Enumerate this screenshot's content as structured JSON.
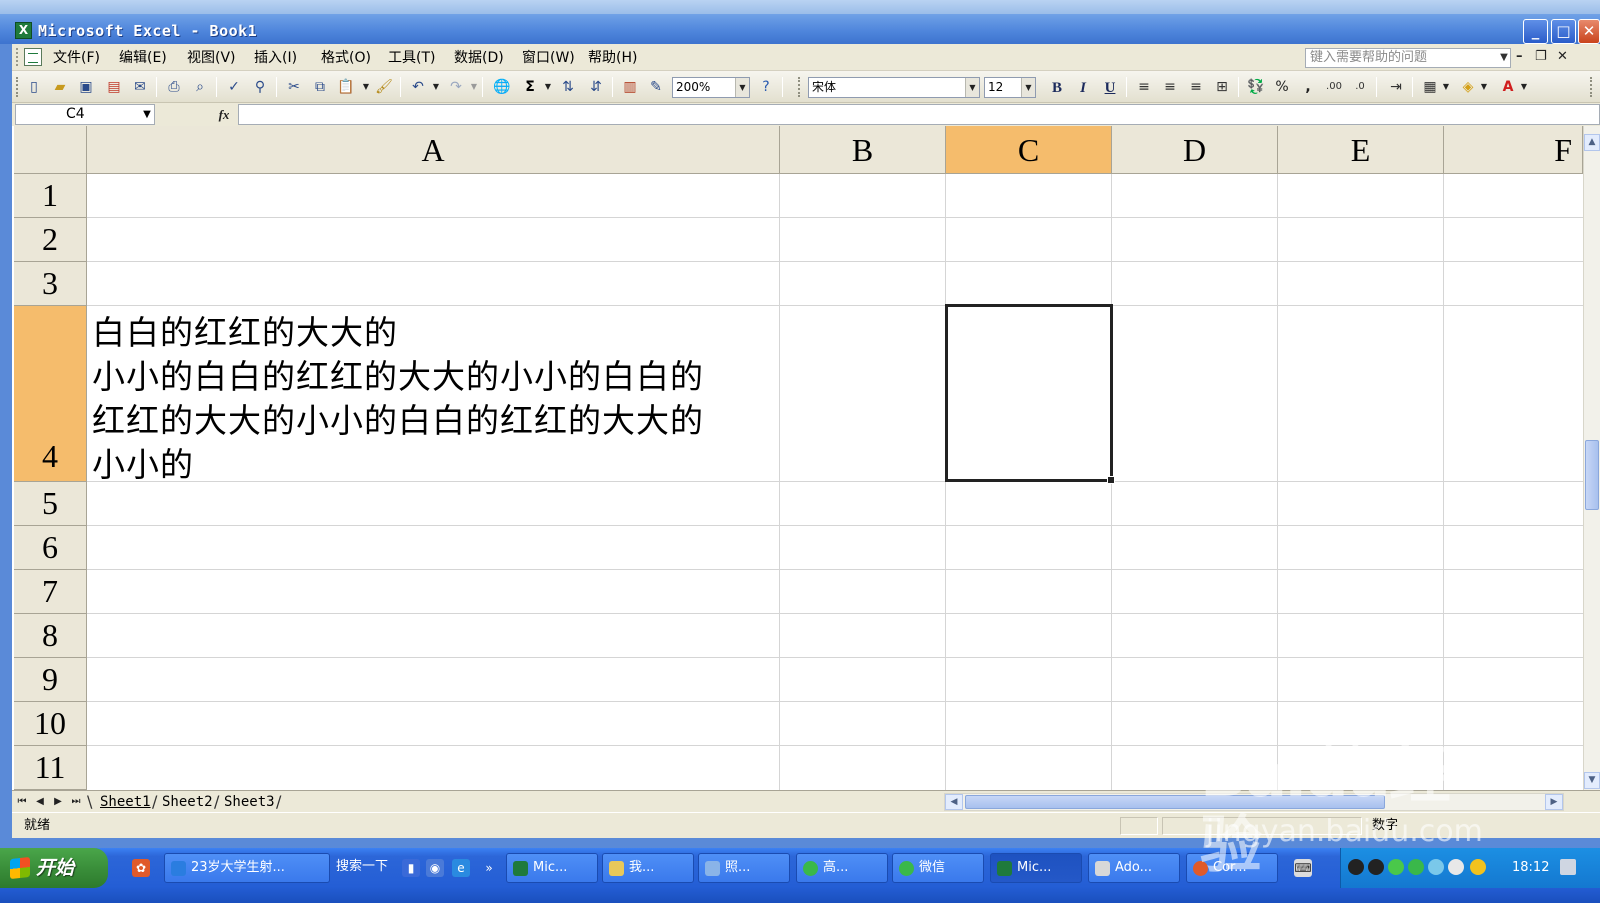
{
  "window": {
    "title": "Microsoft Excel - Book1",
    "min": "_",
    "max": "□",
    "close": "✕"
  },
  "menu": {
    "items": [
      "文件(F)",
      "编辑(E)",
      "视图(V)",
      "插入(I)",
      "格式(O)",
      "工具(T)",
      "数据(D)",
      "窗口(W)",
      "帮助(H)"
    ],
    "help_placeholder": "键入需要帮助的问题"
  },
  "toolbar": {
    "zoom": "200%",
    "font_name": "宋体",
    "font_size": "12",
    "bold": "B",
    "italic": "I",
    "underline": "U",
    "percent": "%",
    "comma": ",",
    "sum": "Σ",
    "font_color_icon": "A"
  },
  "formula_bar": {
    "name_box": "C4",
    "fx": "fx",
    "formula": ""
  },
  "grid": {
    "columns": [
      "A",
      "B",
      "C",
      "D",
      "E",
      "F"
    ],
    "active_column": "C",
    "rows": [
      "1",
      "2",
      "3",
      "4",
      "5",
      "6",
      "7",
      "8",
      "9",
      "10",
      "11"
    ],
    "active_row": "4",
    "cell_a4_lines": [
      "白白的红红的大大的",
      "小小的白白的红红的大大的小小的白白的",
      "红红的大大的小小的白白的红红的大大的",
      "小小的"
    ],
    "selected_cell": "C4"
  },
  "sheets": {
    "tabs": [
      "Sheet1",
      "Sheet2",
      "Sheet3"
    ],
    "active": "Sheet1",
    "nav": [
      "⏮",
      "◀",
      "▶",
      "⏭"
    ]
  },
  "status": {
    "left": "就绪",
    "mode": "数字"
  },
  "taskbar": {
    "start_label": "开始",
    "items": [
      {
        "label": "23岁大学生射..."
      },
      {
        "label": "搜索一下"
      },
      {
        "label": "Mic..."
      },
      {
        "label": "我..."
      },
      {
        "label": "照..."
      },
      {
        "label": "高..."
      },
      {
        "label": "微信"
      },
      {
        "label": "Mic..."
      },
      {
        "label": "Ado..."
      },
      {
        "label": "Cor..."
      }
    ],
    "clock": "18:12"
  },
  "watermark": {
    "logo": "Baidu经验",
    "url": "jingyan.baidu.com"
  },
  "colors": {
    "active_header": "#f5bc6c",
    "chrome": "#ece9d8",
    "title_blue": "#3d73cf",
    "taskbar_blue": "#245ed5"
  }
}
